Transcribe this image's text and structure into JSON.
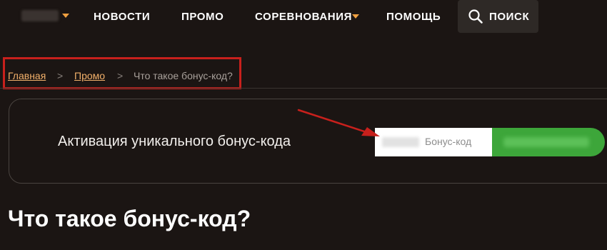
{
  "nav": {
    "logo_icon": "blurred-logo",
    "items": [
      {
        "label": "НОВОСТИ"
      },
      {
        "label": "ПРОМО"
      },
      {
        "label": "СОРЕВНОВАНИЯ"
      },
      {
        "label": "ПОМОЩЬ"
      }
    ],
    "search": {
      "label": "ПОИСК",
      "icon": "search-icon"
    },
    "accent_color": "#f0a040"
  },
  "breadcrumb": {
    "items": [
      {
        "label": "Главная"
      },
      {
        "label": "Промо"
      },
      {
        "label": "Что такое бонус-код?"
      }
    ],
    "separator": ">",
    "highlight_color": "#c8201c"
  },
  "promo": {
    "title": "Активация уникального бонус-кода",
    "input": {
      "placeholder": "Бонус-код"
    },
    "button_color": "#3da63a"
  },
  "heading": "Что такое бонус-код?"
}
